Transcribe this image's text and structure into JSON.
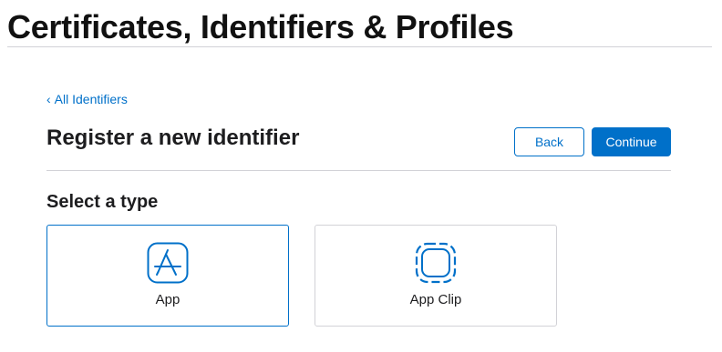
{
  "header": {
    "title": "Certificates, Identifiers & Profiles"
  },
  "nav": {
    "back_link_chevron": "‹",
    "back_link_label": "All Identifiers"
  },
  "page": {
    "title": "Register a new identifier",
    "buttons": {
      "back_label": "Back",
      "continue_label": "Continue"
    }
  },
  "type_selection": {
    "heading": "Select a type",
    "options": [
      {
        "label": "App",
        "icon": "app-store-icon",
        "selected": true
      },
      {
        "label": "App Clip",
        "icon": "app-clip-icon",
        "selected": false
      }
    ]
  },
  "colors": {
    "accent": "#0070c9",
    "text": "#1d1d1f",
    "border": "#d2d2d7"
  }
}
